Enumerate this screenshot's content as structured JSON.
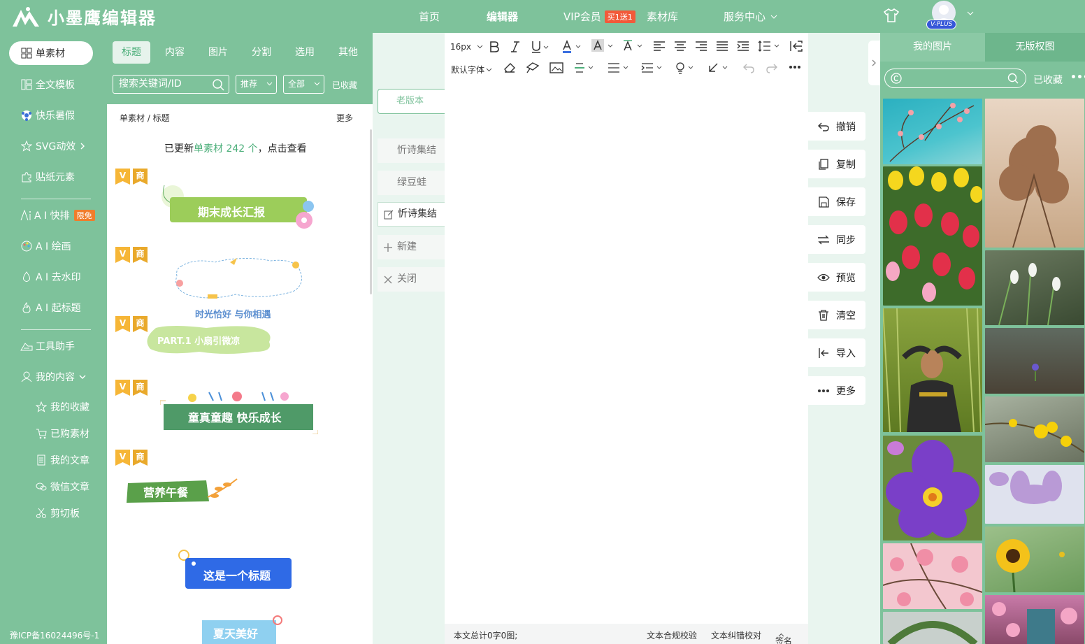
{
  "header": {
    "logo_text": "小墨鹰编辑器",
    "nav": [
      {
        "label": "首页"
      },
      {
        "label": "编辑器"
      },
      {
        "label": "VIP会员",
        "badge": "买1送1"
      },
      {
        "label": "素材库"
      },
      {
        "label": "服务中心"
      }
    ],
    "vip_badge": "V-PLUS"
  },
  "sidebar": {
    "items": [
      {
        "label": "单素材",
        "icon": "grid-icon"
      },
      {
        "label": "全文模板",
        "icon": "template-icon"
      },
      {
        "label": "快乐暑假",
        "icon": "ball-icon"
      },
      {
        "label": "SVG动效",
        "icon": "star-icon"
      },
      {
        "label": "贴纸元素",
        "icon": "puzzle-icon"
      },
      {
        "label": "A I 快排",
        "icon": "ai-icon",
        "badge": "限免"
      },
      {
        "label": "A I 绘画",
        "icon": "palette-icon"
      },
      {
        "label": "A I 去水印",
        "icon": "drop-icon"
      },
      {
        "label": "A I 起标题",
        "icon": "fire-icon"
      },
      {
        "label": "工具助手",
        "icon": "tool-icon"
      },
      {
        "label": "我的内容",
        "icon": "user-icon"
      }
    ],
    "sub_items": [
      {
        "label": "我的收藏",
        "icon": "star-icon"
      },
      {
        "label": "已购素材",
        "icon": "cart-icon"
      },
      {
        "label": "我的文章",
        "icon": "doc-icon"
      },
      {
        "label": "微信文章",
        "icon": "wechat-icon"
      },
      {
        "label": "剪切板",
        "icon": "scissors-icon"
      }
    ],
    "icp": "豫ICP备16024496号-1"
  },
  "materials": {
    "tabs": [
      "标题",
      "内容",
      "图片",
      "分割",
      "选用",
      "其他"
    ],
    "search_placeholder": "搜索关键词/ID",
    "sort": "推荐",
    "filter": "全部",
    "favorites": "已收藏",
    "breadcrumb": "单素材 / 标题",
    "more": "更多",
    "notice_prefix": "已更新",
    "notice_highlight": "单素材 242 个",
    "notice_suffix": "，点击查看",
    "vip_badge": "V",
    "commercial_badge": "商",
    "samples": [
      "期末成长汇报",
      "时光恰好 与你相遇",
      "PART.1 小扇引微凉",
      "童真童趣 快乐成长",
      "营养午餐",
      "这是一个标题",
      "夏天美好"
    ]
  },
  "articles": {
    "old_version": "老版本",
    "items": [
      "忻诗集结",
      "绿豆蛙",
      "忻诗集结"
    ],
    "new": "新建",
    "close": "关闭"
  },
  "editor": {
    "font_size": "16px",
    "font_family": "默认字体",
    "footer_count": "本文总计0字0图;",
    "footer_compliance": "文本合规校验",
    "footer_typo": "文本纠错校对",
    "footer_sign": "签名"
  },
  "actions": [
    "撤销",
    "复制",
    "保存",
    "同步",
    "预览",
    "清空",
    "导入",
    "更多"
  ],
  "images": {
    "tabs": [
      "我的图片",
      "无版权图"
    ],
    "favorites": "已收藏",
    "menu": "•••"
  },
  "colors": {
    "brand": "#7ec29b",
    "accent": "#4caf7a",
    "badge": "#f25a3a"
  }
}
